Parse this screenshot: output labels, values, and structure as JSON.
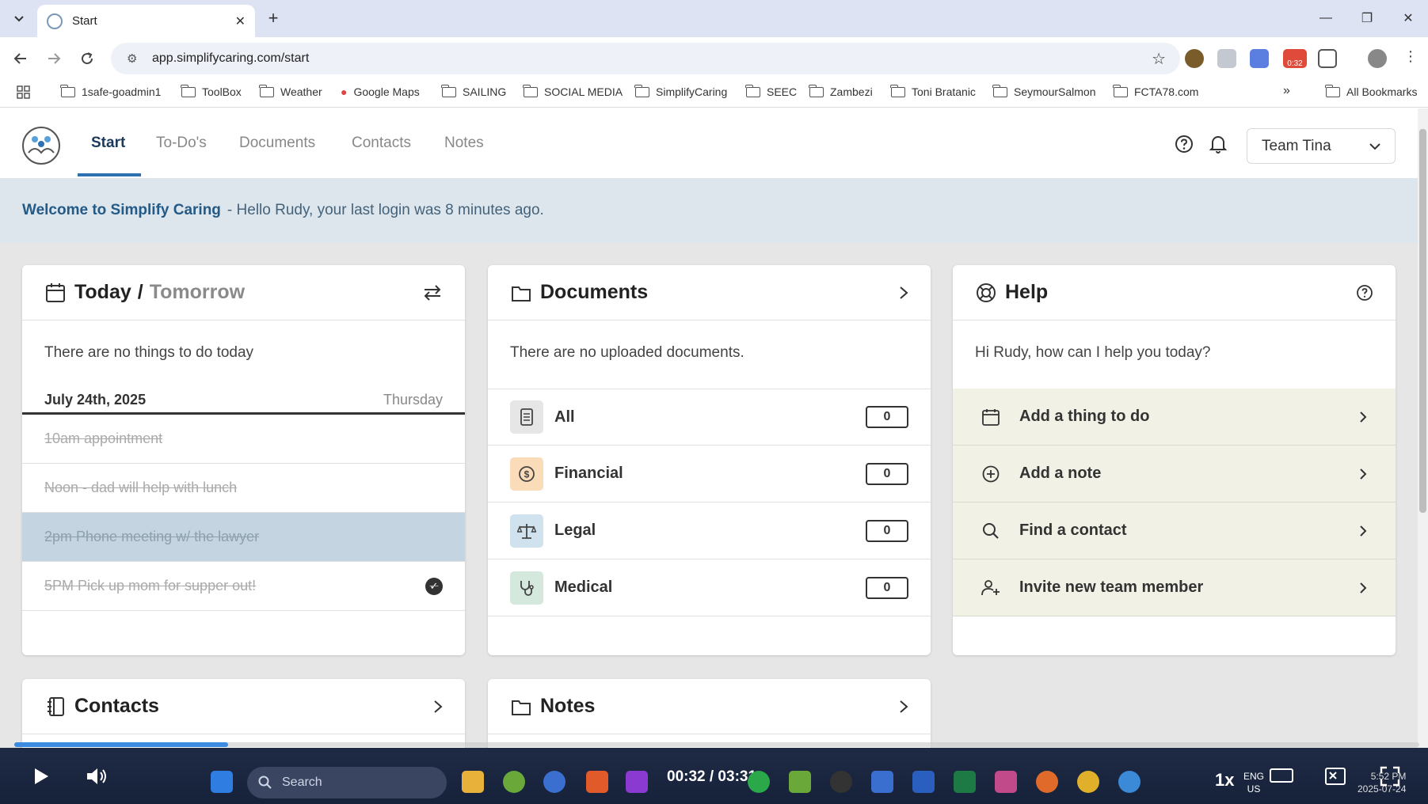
{
  "browser": {
    "tab_title": "Start",
    "url": "app.simplifycaring.com/start",
    "bookmarks": [
      "1safe-goadmin1",
      "ToolBox",
      "Weather",
      "Google Maps",
      "SAILING",
      "SOCIAL MEDIA",
      "SimplifyCaring",
      "SEEC",
      "Zambezi",
      "Toni Bratanic",
      "SeymourSalmon",
      "FCTA78.com"
    ],
    "all_bookmarks": "All Bookmarks",
    "more": "»",
    "extension_badge": "0:32"
  },
  "app": {
    "nav": {
      "start": "Start",
      "todos": "To-Do's",
      "documents": "Documents",
      "contacts": "Contacts",
      "notes": "Notes"
    },
    "team_select": "Team Tina"
  },
  "welcome": {
    "title": "Welcome to Simplify Caring",
    "message": "- Hello Rudy, your last login was 8 minutes ago."
  },
  "today_card": {
    "title_today": "Today",
    "separator": "/",
    "title_tomorrow": "Tomorrow",
    "empty_message": "There are no things to do today",
    "date": "July 24th, 2025",
    "weekday": "Thursday",
    "items": [
      {
        "text": "10am appointment"
      },
      {
        "text": "Noon - dad will help with lunch"
      },
      {
        "text": "2pm Phone meeting w/ the lawyer"
      },
      {
        "text": "5PM Pick up mom for supper out!"
      }
    ]
  },
  "documents_card": {
    "title": "Documents",
    "empty_message": "There are no uploaded documents.",
    "categories": [
      {
        "label": "All",
        "count": "0",
        "icon": "document-icon"
      },
      {
        "label": "Financial",
        "count": "0",
        "icon": "dollar-icon"
      },
      {
        "label": "Legal",
        "count": "0",
        "icon": "scale-icon"
      },
      {
        "label": "Medical",
        "count": "0",
        "icon": "stethoscope-icon"
      }
    ]
  },
  "help_card": {
    "title": "Help",
    "greeting": "Hi Rudy, how can I help you today?",
    "actions": [
      {
        "label": "Add a thing to do",
        "icon": "calendar-icon"
      },
      {
        "label": "Add a note",
        "icon": "plus-circle-icon"
      },
      {
        "label": "Find a contact",
        "icon": "search-icon"
      },
      {
        "label": "Invite new team member",
        "icon": "add-user-icon"
      }
    ]
  },
  "contacts_card": {
    "title": "Contacts"
  },
  "notes_card": {
    "title": "Notes"
  },
  "player": {
    "time": "00:32 / 03:31",
    "speed": "1x",
    "progress": 0.152,
    "search_placeholder": "Search",
    "lang": "ENG",
    "region": "US",
    "clock_time": "5:52 PM",
    "clock_date": "2025-07-24"
  },
  "colors": {
    "accent": "#2d71b3",
    "banner": "#dce6ec",
    "help_row": "#f1f1e6",
    "highlight_row": "#c4d5e1"
  }
}
